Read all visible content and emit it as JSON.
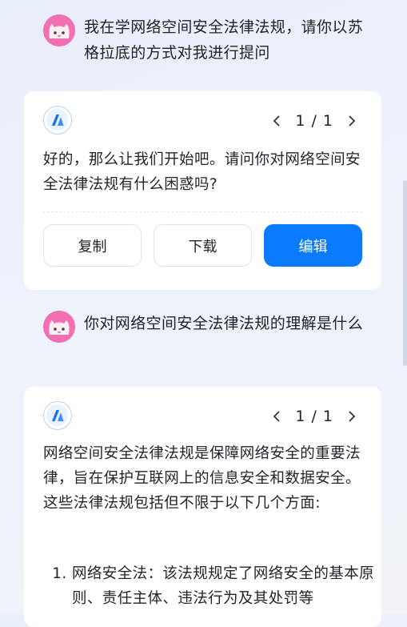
{
  "messages": [
    {
      "role": "user",
      "text": "我在学网络空间安全法律法规，请你以苏格拉底的方式对我进行提问"
    },
    {
      "role": "assistant",
      "pager": "1 / 1",
      "text": "好的，那么让我们开始吧。请问你对网络空间安全法律法规有什么困惑吗?",
      "actions": {
        "copy": "复制",
        "download": "下载",
        "edit": "编辑"
      }
    },
    {
      "role": "user",
      "text": "你对网络空间安全法律法规的理解是什么"
    },
    {
      "role": "assistant",
      "pager": "1 / 1",
      "text": "网络空间安全法律法规是保障网络安全的重要法律，旨在保护互联网上的信息安全和数据安全。这些法律法规包括但不限于以下几个方面:",
      "list": [
        "网络安全法：该法规规定了网络安全的基本原则、责任主体、违法行为及其处罚等"
      ]
    }
  ],
  "colors": {
    "primary": "#0a7bff",
    "user_avatar": "#f36fb3",
    "page_bg": "#eef2fb"
  },
  "icons": {
    "user_avatar": "cat-avatar-icon",
    "bot_avatar": "ai-logo-icon",
    "prev": "chevron-left-icon",
    "next": "chevron-right-icon"
  }
}
